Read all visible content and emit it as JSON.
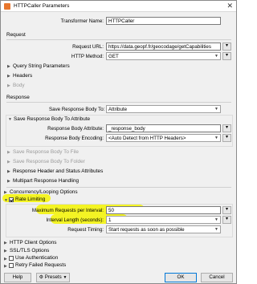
{
  "window": {
    "title": "HTTPCaller Parameters",
    "close_glyph": "✕"
  },
  "transformer_name": {
    "label": "Transformer Name:",
    "value": "HTTPCaller"
  },
  "request": {
    "section_label": "Request",
    "url_label": "Request URL:",
    "url_value": "https://data.geopf.fr/geocodage/getCapabilities",
    "method_label": "HTTP Method:",
    "method_value": "GET",
    "query_params": "Query String Parameters",
    "headers": "Headers",
    "body": "Body"
  },
  "response": {
    "section_label": "Response",
    "save_body_to_label": "Save Response Body To:",
    "save_body_to_value": "Attribute",
    "save_to_attribute": "Save Response Body To Attribute",
    "body_attr_label": "Response Body Attribute:",
    "body_attr_value": "_response_body",
    "body_enc_label": "Response Body Encoding:",
    "body_enc_value": "<Auto Detect from HTTP Headers>",
    "save_to_file": "Save Response Body To File",
    "save_to_folder": "Save Response Body To Folder",
    "header_status": "Response Header and Status Attributes",
    "multipart": "Multipart Response Handling"
  },
  "concurrency": "Concurrency/Looping Options",
  "rate_limiting": {
    "label": "Rate Limiting",
    "max_req_label": "Maximum Requests per Interval:",
    "max_req_value": "50",
    "interval_label": "Interval Length (seconds):",
    "interval_value": "1",
    "timing_label": "Request Timing:",
    "timing_value": "Start requests as soon as possible"
  },
  "http_client": "HTTP Client Options",
  "ssl_tls": "SSL/TLS Options",
  "use_auth": "Use Authentication",
  "retry_failed": "Retry Failed Requests",
  "buttons": {
    "help": "Help",
    "presets": "Presets",
    "ok": "OK",
    "cancel": "Cancel"
  },
  "colors": {
    "highlight": "#f5f500",
    "accent": "#0078d7"
  }
}
